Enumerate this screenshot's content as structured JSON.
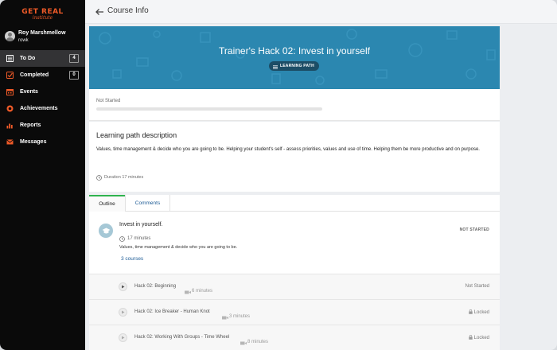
{
  "brand": {
    "name": "GET REAL",
    "tagline": "institute"
  },
  "user": {
    "name": "Roy Marshmellow",
    "subtitle": "rowk"
  },
  "sidebar": {
    "items": [
      {
        "label": "To Do",
        "badge": "4",
        "icon": "list-icon",
        "active": true
      },
      {
        "label": "Completed",
        "badge": "0",
        "icon": "checkbox-icon",
        "active": false
      },
      {
        "label": "Events",
        "icon": "calendar-icon",
        "active": false
      },
      {
        "label": "Achievements",
        "icon": "badge-icon",
        "active": false
      },
      {
        "label": "Reports",
        "icon": "bar-chart-icon",
        "active": false
      },
      {
        "label": "Messages",
        "icon": "envelope-icon",
        "active": false
      }
    ]
  },
  "header": {
    "title": "Course Info",
    "back_icon": "arrow-left-icon"
  },
  "hero": {
    "title": "Trainer's Hack 02: Invest in yourself",
    "badge": "LEARNING PATH"
  },
  "progress": {
    "status": "Not Started",
    "percent": 0
  },
  "description": {
    "heading": "Learning path description",
    "text": "Values, time management & decide who you are going to be. Helping your student's self - assess priorities, values and use of time. Helping them be more productive and on purpose.",
    "duration": "Duration 17 minutes"
  },
  "tabs": [
    {
      "label": "Outline",
      "active": true
    },
    {
      "label": "Comments",
      "active": false
    }
  ],
  "lesson": {
    "title": "Invest in yourself.",
    "duration": "17 minutes",
    "status": "NOT STARTED",
    "description": "Values, time management & decide who you are going to be.",
    "courses_link": "3 courses"
  },
  "courses": [
    {
      "name": "Hack 02: Beginning",
      "video_duration": "6 minutes",
      "status": "Not Started",
      "locked": false
    },
    {
      "name": "Hack 02: Ice Breaker - Human Knot",
      "video_duration": "3 minutes",
      "status": "Locked",
      "locked": true
    },
    {
      "name": "Hack 02: Working With Groups - Time Wheel",
      "video_duration": "8 minutes",
      "status": "Locked",
      "locked": true
    }
  ],
  "colors": {
    "sidebar_bg": "#0a0a0a",
    "brand_orange": "#ef5a28",
    "hero_blue": "#2b87b0",
    "active_tab_green": "#2fb34e",
    "link_blue": "#1e5c96"
  }
}
